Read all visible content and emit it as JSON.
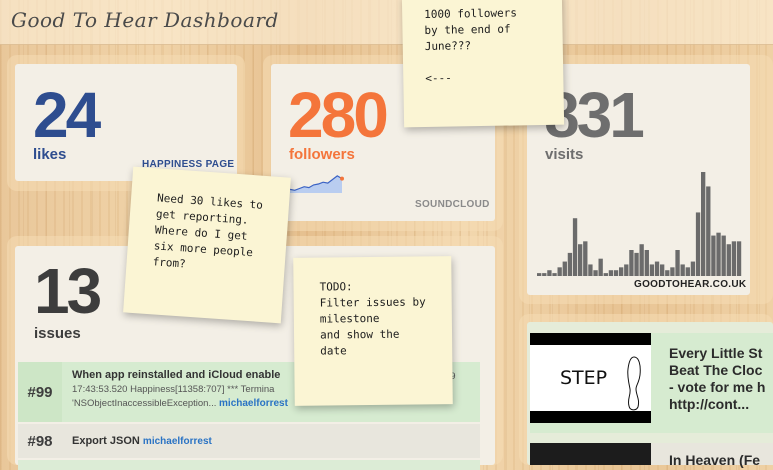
{
  "header": {
    "title": "Good To Hear Dashboard"
  },
  "likes": {
    "value": "24",
    "label": "likes",
    "source": "HAPPINESS PAGE",
    "color": "#2e4d8f"
  },
  "followers": {
    "value": "280",
    "label": "followers",
    "source": "SOUNDCLOUD",
    "color": "#f4753b"
  },
  "visits": {
    "value": "831",
    "label": "visits",
    "source": "GOODTOHEAR.CO.UK",
    "color": "#6e6e6e"
  },
  "issues": {
    "value": "13",
    "label": "issues",
    "rows": [
      {
        "number": "#99",
        "title": "When app reinstalled and iCloud enable",
        "meta_line1": "17:43:53.520 Happiness[11358:707] *** Termina",
        "meta_line2": "'NSObjectInaccessibleException...",
        "author": "michaelforrest",
        "trailing": "19"
      },
      {
        "number": "#98",
        "title": "Export JSON",
        "author": "michaelforrest"
      }
    ]
  },
  "notes": {
    "followers_goal": "1000 followers\nby the end of\nJune???\n\n<---",
    "likes_goal": "Need 30 likes to\nget reporting.\nWhere do I get\nsix more people\nfrom?",
    "todo": "TODO:\nFilter issues by\nmilestone\nand show the\ndate"
  },
  "feed": {
    "items": [
      {
        "thumb_label": "STEP",
        "text_lines": [
          "Every Little St",
          "Beat The Cloc",
          "- vote for me h",
          "http://cont..."
        ]
      },
      {
        "text_lines": [
          "In Heaven (Fe"
        ]
      }
    ]
  },
  "sparkline": {
    "values": [
      0.2,
      0.15,
      0.25,
      0.35,
      0.3,
      0.45,
      0.5,
      0.6,
      0.55,
      0.75,
      0.95,
      0.8
    ]
  },
  "visits_chart": {
    "values": [
      1,
      1,
      2,
      1,
      3,
      5,
      8,
      20,
      11,
      12,
      4,
      2,
      6,
      1,
      2,
      2,
      3,
      4,
      9,
      8,
      11,
      9,
      4,
      5,
      4,
      2,
      3,
      9,
      4,
      3,
      5,
      22,
      36,
      31,
      14,
      15,
      14,
      11,
      12,
      12
    ]
  }
}
